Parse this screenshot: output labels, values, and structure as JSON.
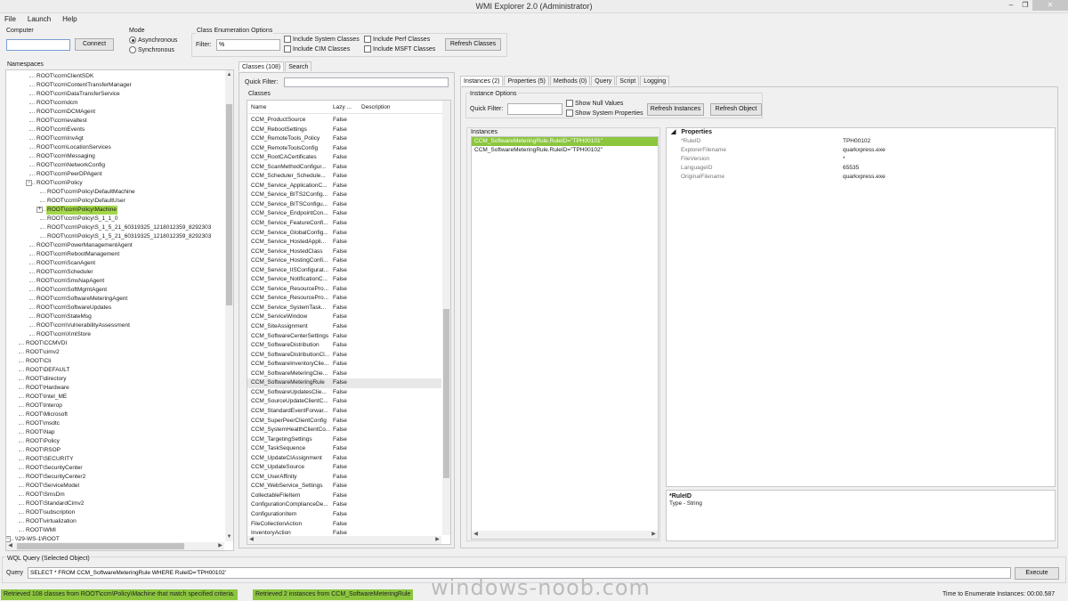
{
  "window": {
    "title": "WMI Explorer 2.0 (Administrator)"
  },
  "menu": [
    "File",
    "Launch",
    "Help"
  ],
  "computer": {
    "group_label": "Computer",
    "value": "",
    "connect_label": "Connect"
  },
  "mode": {
    "group_label": "Mode",
    "options": [
      "Asynchronous",
      "Synchronous"
    ],
    "selected": "Asynchronous"
  },
  "class_enum": {
    "group_label": "Class Enumeration Options",
    "filter_label": "Filter:",
    "filter_value": "%",
    "checkboxes": [
      "Include System Classes",
      "Include CIM Classes",
      "Include Perf Classes",
      "Include MSFT Classes"
    ],
    "refresh_label": "Refresh Classes"
  },
  "namespaces": {
    "label": "Namespaces",
    "items": [
      {
        "text": "ROOT\\ccm\\ClientSDK",
        "level": 2
      },
      {
        "text": "ROOT\\ccm\\ContentTransferManager",
        "level": 2
      },
      {
        "text": "ROOT\\ccm\\DataTransferService",
        "level": 2
      },
      {
        "text": "ROOT\\ccm\\dcm",
        "level": 2
      },
      {
        "text": "ROOT\\ccm\\DCMAgent",
        "level": 2
      },
      {
        "text": "ROOT\\ccm\\evaltest",
        "level": 2
      },
      {
        "text": "ROOT\\ccm\\Events",
        "level": 2
      },
      {
        "text": "ROOT\\ccm\\InvAgt",
        "level": 2
      },
      {
        "text": "ROOT\\ccm\\LocationServices",
        "level": 2
      },
      {
        "text": "ROOT\\ccm\\Messaging",
        "level": 2
      },
      {
        "text": "ROOT\\ccm\\NetworkConfig",
        "level": 2
      },
      {
        "text": "ROOT\\ccm\\PeerDPAgent",
        "level": 2
      },
      {
        "text": "ROOT\\ccm\\Policy",
        "level": 2,
        "expander": "−"
      },
      {
        "text": "ROOT\\ccm\\Policy\\DefaultMachine",
        "level": 3
      },
      {
        "text": "ROOT\\ccm\\Policy\\DefaultUser",
        "level": 3
      },
      {
        "text": "ROOT\\ccm\\Policy\\Machine",
        "level": 3,
        "expander": "+",
        "selected": true
      },
      {
        "text": "ROOT\\ccm\\Policy\\S_1_1_0",
        "level": 3
      },
      {
        "text": "ROOT\\ccm\\Policy\\S_1_5_21_60319325_1218012359_8292303",
        "level": 3
      },
      {
        "text": "ROOT\\ccm\\Policy\\S_1_5_21_60319325_1218012359_8292303",
        "level": 3
      },
      {
        "text": "ROOT\\ccm\\PowerManagementAgent",
        "level": 2
      },
      {
        "text": "ROOT\\ccm\\RebootManagement",
        "level": 2
      },
      {
        "text": "ROOT\\ccm\\ScanAgent",
        "level": 2
      },
      {
        "text": "ROOT\\ccm\\Scheduler",
        "level": 2
      },
      {
        "text": "ROOT\\ccm\\SmsNapAgent",
        "level": 2
      },
      {
        "text": "ROOT\\ccm\\SoftMgmtAgent",
        "level": 2
      },
      {
        "text": "ROOT\\ccm\\SoftwareMeteringAgent",
        "level": 2
      },
      {
        "text": "ROOT\\ccm\\SoftwareUpdates",
        "level": 2
      },
      {
        "text": "ROOT\\ccm\\StateMsg",
        "level": 2
      },
      {
        "text": "ROOT\\ccm\\VulnerabilityAssessment",
        "level": 2
      },
      {
        "text": "ROOT\\ccm\\XmlStore",
        "level": 2
      },
      {
        "text": "ROOT\\CCMVDI",
        "level": 1
      },
      {
        "text": "ROOT\\cimv2",
        "level": 1
      },
      {
        "text": "ROOT\\Cli",
        "level": 1
      },
      {
        "text": "ROOT\\DEFAULT",
        "level": 1
      },
      {
        "text": "ROOT\\directory",
        "level": 1
      },
      {
        "text": "ROOT\\Hardware",
        "level": 1
      },
      {
        "text": "ROOT\\Intel_ME",
        "level": 1
      },
      {
        "text": "ROOT\\Interop",
        "level": 1
      },
      {
        "text": "ROOT\\Microsoft",
        "level": 1
      },
      {
        "text": "ROOT\\msdtc",
        "level": 1
      },
      {
        "text": "ROOT\\Nap",
        "level": 1
      },
      {
        "text": "ROOT\\Policy",
        "level": 1
      },
      {
        "text": "ROOT\\RSOP",
        "level": 1
      },
      {
        "text": "ROOT\\SECURITY",
        "level": 1
      },
      {
        "text": "ROOT\\SecurityCenter",
        "level": 1
      },
      {
        "text": "ROOT\\SecurityCenter2",
        "level": 1
      },
      {
        "text": "ROOT\\ServiceModel",
        "level": 1
      },
      {
        "text": "ROOT\\SmsDm",
        "level": 1
      },
      {
        "text": "ROOT\\StandardCimv2",
        "level": 1
      },
      {
        "text": "ROOT\\subscription",
        "level": 1
      },
      {
        "text": "ROOT\\virtualization",
        "level": 1
      },
      {
        "text": "ROOT\\WMI",
        "level": 1
      },
      {
        "text": "\\\\29-WS-1\\ROOT",
        "level": 0,
        "expander": "−"
      }
    ]
  },
  "classes": {
    "tabs": [
      "Classes (108)",
      "Search"
    ],
    "quick_filter_label": "Quick Filter:",
    "group_label": "Classes",
    "columns": [
      "Name",
      "Lazy ...",
      "Description"
    ],
    "rows": [
      [
        "CCM_ProductSource",
        "False"
      ],
      [
        "CCM_RebootSettings",
        "False"
      ],
      [
        "CCM_RemoteTools_Policy",
        "False"
      ],
      [
        "CCM_RemoteToolsConfig",
        "False"
      ],
      [
        "CCM_RootCACertificates",
        "False"
      ],
      [
        "CCM_ScanMethodConfigur...",
        "False"
      ],
      [
        "CCM_Scheduler_Schedule...",
        "False"
      ],
      [
        "CCM_Service_ApplicationC...",
        "False"
      ],
      [
        "CCM_Service_BITS2Config...",
        "False"
      ],
      [
        "CCM_Service_BITSConfigu...",
        "False"
      ],
      [
        "CCM_Service_EndpointCon...",
        "False"
      ],
      [
        "CCM_Service_FeatureConfi...",
        "False"
      ],
      [
        "CCM_Service_GlobalConfig...",
        "False"
      ],
      [
        "CCM_Service_HostedAppli...",
        "False"
      ],
      [
        "CCM_Service_HostedClass",
        "False"
      ],
      [
        "CCM_Service_HostingConfi...",
        "False"
      ],
      [
        "CCM_Service_IISConfigurat...",
        "False"
      ],
      [
        "CCM_Service_NotificationC...",
        "False"
      ],
      [
        "CCM_Service_ResourcePro...",
        "False"
      ],
      [
        "CCM_Service_ResourcePro...",
        "False"
      ],
      [
        "CCM_Service_SystemTask...",
        "False"
      ],
      [
        "CCM_ServiceWindow",
        "False"
      ],
      [
        "CCM_SiteAssignment",
        "False"
      ],
      [
        "CCM_SoftwareCenterSettings",
        "False"
      ],
      [
        "CCM_SoftwareDistribution",
        "False"
      ],
      [
        "CCM_SoftwareDistributionCl...",
        "False"
      ],
      [
        "CCM_SoftwareInventoryClie...",
        "False"
      ],
      [
        "CCM_SoftwareMeteringClie...",
        "False"
      ],
      [
        "CCM_SoftwareMeteringRule",
        "False"
      ],
      [
        "CCM_SoftwareUpdatesClie...",
        "False"
      ],
      [
        "CCM_SourceUpdateClientC...",
        "False"
      ],
      [
        "CCM_StandardEventForwar...",
        "False"
      ],
      [
        "CCM_SuperPeerClientConfig",
        "False"
      ],
      [
        "CCM_SystemHealthClientCo...",
        "False"
      ],
      [
        "CCM_TargetingSettings",
        "False"
      ],
      [
        "CCM_TaskSequence",
        "False"
      ],
      [
        "CCM_UpdateCIAssignment",
        "False"
      ],
      [
        "CCM_UpdateSource",
        "False"
      ],
      [
        "CCM_UserAffinity",
        "False"
      ],
      [
        "CCM_WebService_Settings",
        "False"
      ],
      [
        "CollectableFileItem",
        "False"
      ],
      [
        "ConfigurationComplianceDe...",
        "False"
      ],
      [
        "ConfigurationItem",
        "False"
      ],
      [
        "FileCollectionAction",
        "False"
      ],
      [
        "InventoryAction",
        "False"
      ]
    ]
  },
  "right": {
    "tabs": [
      "Instances (2)",
      "Properties (5)",
      "Methods (0)",
      "Query",
      "Script",
      "Logging"
    ],
    "instance_options_label": "Instance Options",
    "quick_filter_label": "Quick Filter:",
    "checkboxes": [
      "Show Null Values",
      "Show System Properties"
    ],
    "refresh_instances_label": "Refresh Instances",
    "refresh_object_label": "Refresh Object",
    "instances_label": "Instances",
    "instances": [
      "CCM_SoftwareMeteringRule.RuleID=\"TPH00101\"",
      "CCM_SoftwareMeteringRule.RuleID=\"TPH00102\""
    ],
    "properties_header": "Properties",
    "properties": [
      [
        "*RuleID",
        "TPH00102"
      ],
      [
        "ExplorerFilename",
        "quarkxpress.exe"
      ],
      [
        "FileVersion",
        "*"
      ],
      [
        "LanguageID",
        "65535"
      ],
      [
        "OriginalFilename",
        "quarkxpress.exe"
      ]
    ],
    "desc_title": "*RuleID",
    "desc_text": "Type - String"
  },
  "wql": {
    "group_label": "WQL Query (Selected Object)",
    "query_label": "Query",
    "query_value": "SELECT * FROM CCM_SoftwareMeteringRule WHERE RuleID='TPH00102'",
    "execute_label": "Execute"
  },
  "status": {
    "left1": "Retrieved 108 classes from ROOT\\ccm\\Policy\\Machine that match specified criteria.",
    "left2": "Retrieved 2 instances from CCM_SoftwareMeteringRule",
    "watermark": "windows-noob.com",
    "right": "Time to Enumerate Instances: 00:00.587"
  }
}
